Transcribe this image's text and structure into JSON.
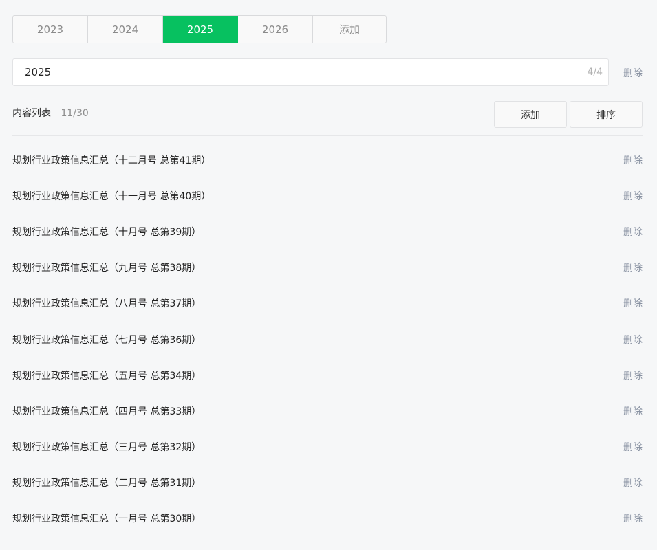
{
  "year_tabs": [
    {
      "label": "2023",
      "active": false
    },
    {
      "label": "2024",
      "active": false
    },
    {
      "label": "2025",
      "active": true
    },
    {
      "label": "2026",
      "active": false
    },
    {
      "label": "添加",
      "active": false
    }
  ],
  "year_editor": {
    "value": "2025",
    "counter": "4/4",
    "delete_label": "删除"
  },
  "content_list": {
    "title": "内容列表",
    "count": "11/30",
    "add_label": "添加",
    "sort_label": "排序",
    "items": [
      {
        "title": "规划行业政策信息汇总（十二月号 总第41期）",
        "delete_label": "删除"
      },
      {
        "title": "规划行业政策信息汇总（十一月号 总第40期）",
        "delete_label": "删除"
      },
      {
        "title": "规划行业政策信息汇总（十月号 总第39期）",
        "delete_label": "删除"
      },
      {
        "title": "规划行业政策信息汇总（九月号 总第38期）",
        "delete_label": "删除"
      },
      {
        "title": "规划行业政策信息汇总（八月号 总第37期）",
        "delete_label": "删除"
      },
      {
        "title": "规划行业政策信息汇总（七月号 总第36期）",
        "delete_label": "删除"
      },
      {
        "title": "规划行业政策信息汇总（五月号 总第34期）",
        "delete_label": "删除"
      },
      {
        "title": "规划行业政策信息汇总（四月号 总第33期）",
        "delete_label": "删除"
      },
      {
        "title": "规划行业政策信息汇总（三月号 总第32期）",
        "delete_label": "删除"
      },
      {
        "title": "规划行业政策信息汇总（二月号 总第31期）",
        "delete_label": "删除"
      },
      {
        "title": "规划行业政策信息汇总（一月号 总第30期）",
        "delete_label": "删除"
      }
    ]
  },
  "colors": {
    "accent": "#07c160",
    "delete_text": "#8a93a3",
    "background": "#f6f7f8"
  }
}
